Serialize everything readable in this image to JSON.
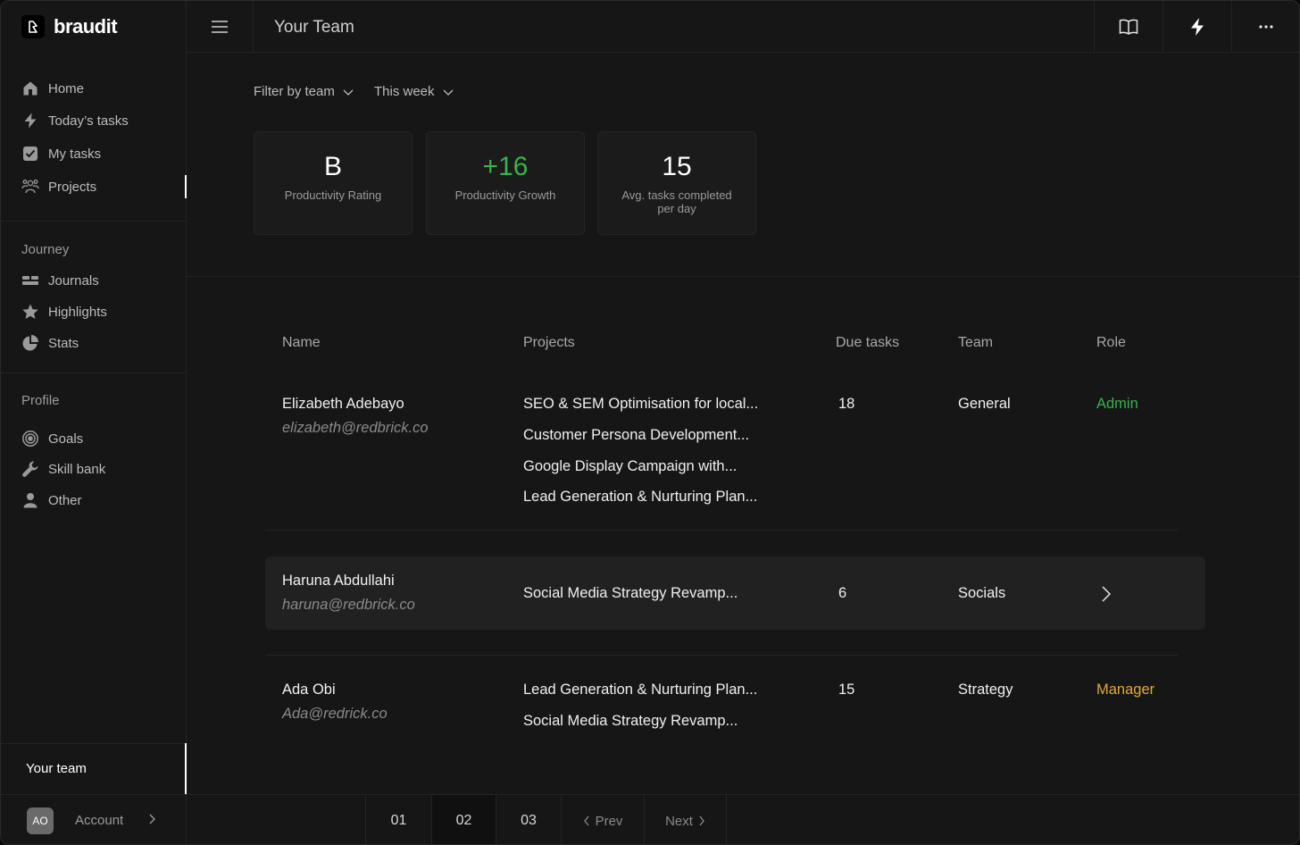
{
  "app": {
    "brand": "braudit"
  },
  "header": {
    "title": "Your Team"
  },
  "sidebar": {
    "main": [
      {
        "label": "Home",
        "icon": "home-icon"
      },
      {
        "label": "Today’s tasks",
        "icon": "bolt-icon"
      },
      {
        "label": "My tasks",
        "icon": "checkbox-icon"
      },
      {
        "label": "Projects",
        "icon": "people-icon"
      }
    ],
    "journey": {
      "label": "Journey",
      "items": [
        {
          "label": "Journals",
          "icon": "journals-icon"
        },
        {
          "label": "Highlights",
          "icon": "star-icon"
        },
        {
          "label": "Stats",
          "icon": "pie-chart-icon"
        }
      ]
    },
    "profile": {
      "label": "Profile",
      "items": [
        {
          "label": "Goals",
          "icon": "target-icon"
        },
        {
          "label": "Skill bank",
          "icon": "wrench-icon"
        },
        {
          "label": "Other",
          "icon": "user-icon"
        }
      ]
    },
    "your_team": "Your team",
    "account": {
      "initials": "AO",
      "label": "Account"
    }
  },
  "filters": {
    "team": "Filter by team",
    "period": "This week"
  },
  "stats": [
    {
      "value": "B",
      "label": "Productivity Rating"
    },
    {
      "value": "+16",
      "label": "Productivity Growth",
      "color": "#38b24d"
    },
    {
      "value": "15",
      "label": "Avg. tasks completed per day"
    }
  ],
  "table": {
    "headers": {
      "name": "Name",
      "projects": "Projects",
      "due": "Due tasks",
      "team": "Team",
      "role": "Role"
    },
    "rows": [
      {
        "name": "Elizabeth Adebayo",
        "email": "elizabeth@redbrick.co",
        "projects": [
          "SEO & SEM Optimisation for local...",
          "Customer Persona Development...",
          "Google Display Campaign with...",
          "Lead Generation & Nurturing Plan..."
        ],
        "due": "18",
        "team": "General",
        "role": "Admin"
      },
      {
        "name": "Haruna Abdullahi",
        "email": "haruna@redbrick.co",
        "projects": [
          "Social Media Strategy Revamp..."
        ],
        "due": "6",
        "team": "Socials",
        "role": ""
      },
      {
        "name": "Ada Obi",
        "email": "Ada@redrick.co",
        "projects": [
          "Lead Generation & Nurturing Plan...",
          "Social Media Strategy Revamp..."
        ],
        "due": "15",
        "team": "Strategy",
        "role": "Manager"
      }
    ]
  },
  "pagination": {
    "pages": [
      "01",
      "02",
      "03"
    ],
    "current": "02",
    "prev": "Prev",
    "next": "Next"
  },
  "colors": {
    "accent_green": "#38b24d",
    "accent_orange": "#e0a93c",
    "background": "#161616"
  }
}
